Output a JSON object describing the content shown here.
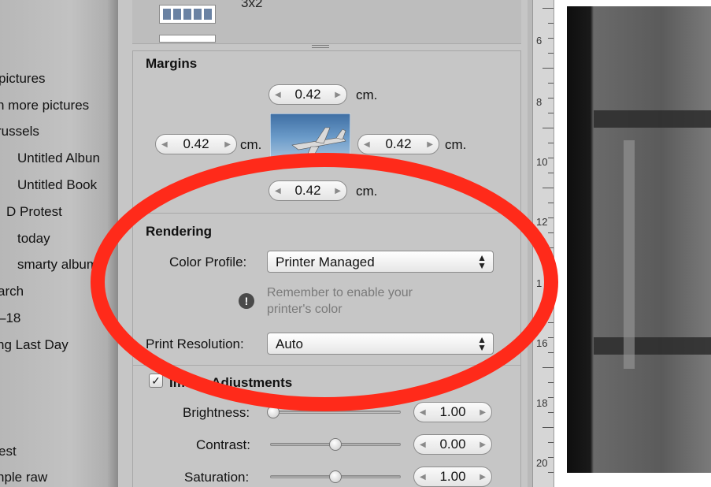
{
  "sidebar": {
    "items": [
      "pictures",
      "n more pictures",
      "russels",
      "Untitled Albun",
      "Untitled Book",
      "D Protest",
      "today",
      "smarty album",
      "arch",
      "–18",
      "ng Last Day",
      "est",
      "nple raw"
    ]
  },
  "top": {
    "thumb_label": "3x2"
  },
  "margins": {
    "title": "Margins",
    "top": "0.42",
    "left": "0.42",
    "right": "0.42",
    "bottom": "0.42",
    "unit": "cm."
  },
  "rendering": {
    "title": "Rendering",
    "color_profile_label": "Color Profile:",
    "color_profile_value": "Printer Managed",
    "warning_text": "Remember to enable your printer's color",
    "print_resolution_label": "Print Resolution:",
    "print_resolution_value": "Auto"
  },
  "adjustments": {
    "title": "Image Adjustments",
    "brightness_label": "Brightness:",
    "brightness_value": "1.00",
    "contrast_label": "Contrast:",
    "contrast_value": "0.00",
    "saturation_label": "Saturation:",
    "saturation_value": "1.00"
  },
  "ruler": {
    "labels": [
      "6",
      "8",
      "10",
      "12",
      "1",
      "16",
      "18",
      "20"
    ]
  },
  "colors": {
    "annotation": "#ff2a1a",
    "panel_bg": "#c6c6c6"
  }
}
